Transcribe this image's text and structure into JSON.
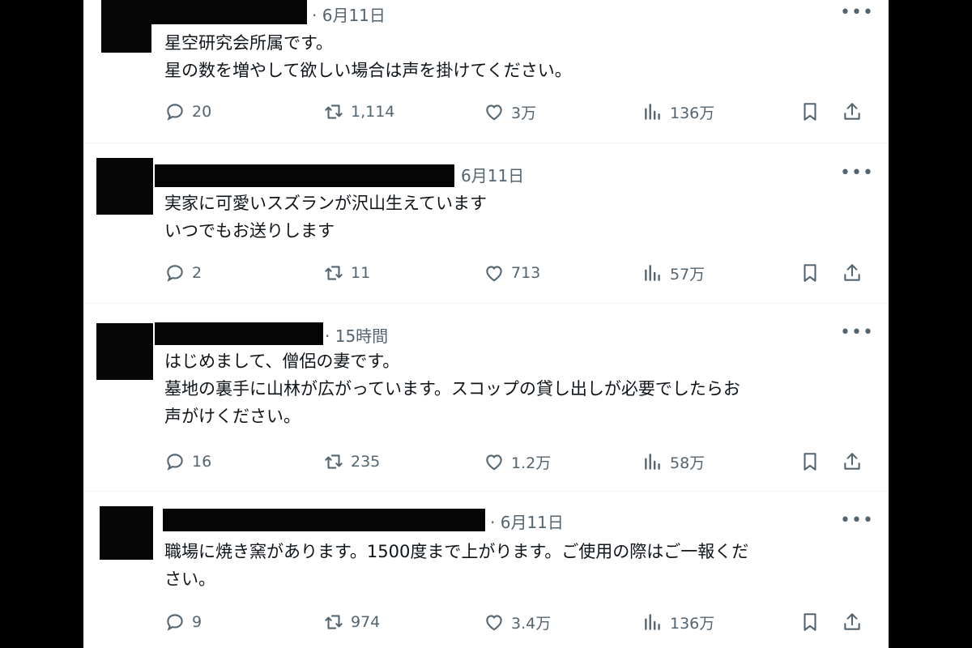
{
  "tweets": [
    {
      "time": "6月11日",
      "text": "星空研究会所属です。\n星の数を増やして欲しい場合は声を掛けてください。",
      "replies": "20",
      "retweets": "1,114",
      "likes": "3万",
      "views": "136万"
    },
    {
      "time": "6月11日",
      "text": "実家に可愛いスズランが沢山生えています\nいつでもお送りします",
      "replies": "2",
      "retweets": "11",
      "likes": "713",
      "views": "57万"
    },
    {
      "time": "15時間",
      "text": "はじめまして、僧侶の妻です。\n墓地の裏手に山林が広がっています。スコップの貸し出しが必要でしたらお\n声がけください。",
      "replies": "16",
      "retweets": "235",
      "likes": "1.2万",
      "views": "58万"
    },
    {
      "time": "6月11日",
      "text": "職場に焼き窯があります。1500度まで上がります。ご使用の際はご一報くだ\nさい。",
      "replies": "9",
      "retweets": "974",
      "likes": "3.4万",
      "views": "136万"
    }
  ],
  "icons": {
    "more": "more-icon",
    "reply": "reply-icon",
    "retweet": "retweet-icon",
    "like": "like-icon",
    "views": "views-icon",
    "bookmark": "bookmark-icon",
    "share": "share-icon"
  },
  "colors": {
    "text": "#0f1419",
    "secondary": "#536471",
    "divider": "#eff3f4",
    "background": "#ffffff"
  }
}
